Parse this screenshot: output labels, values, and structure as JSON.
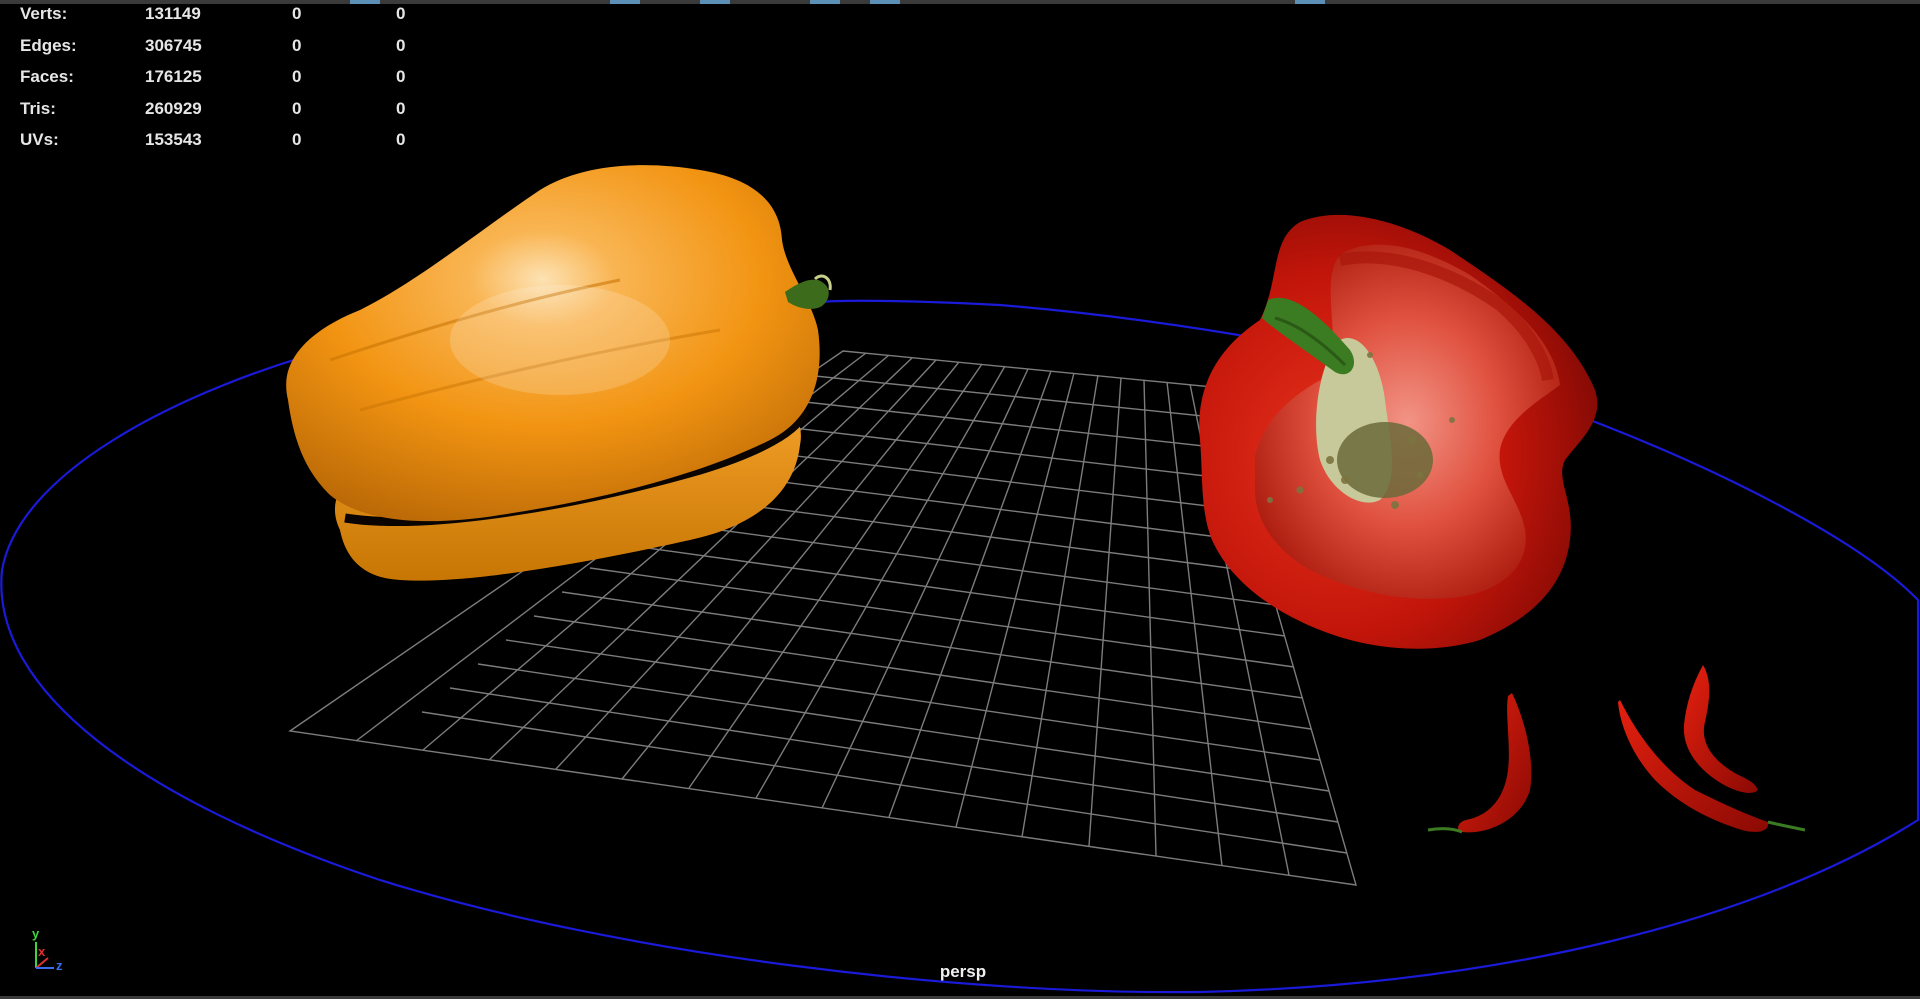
{
  "hud": {
    "rows": [
      {
        "label": "Verts:",
        "total": "131149",
        "selected": "0",
        "component": "0"
      },
      {
        "label": "Edges:",
        "total": "306745",
        "selected": "0",
        "component": "0"
      },
      {
        "label": "Faces:",
        "total": "176125",
        "selected": "0",
        "component": "0"
      },
      {
        "label": "Tris:",
        "total": "260929",
        "selected": "0",
        "component": "0"
      },
      {
        "label": "UVs:",
        "total": "153543",
        "selected": "0",
        "component": "0"
      }
    ]
  },
  "camera_label": "persp",
  "axis_gizmo": {
    "y": "y",
    "x": "x",
    "z": "z"
  },
  "colors": {
    "background": "#000000",
    "grid": "#8a8a8a",
    "ring": "#1a1ad8",
    "yellow_pepper": "#f29412",
    "red_pepper": "#c8160c",
    "axis_y": "#3dd63d",
    "axis_x": "#e03030",
    "axis_z": "#3a6cf0"
  },
  "objects": [
    "yellow-bell-pepper",
    "halved-red-bell-pepper",
    "red-chili-pepper",
    "red-chili-pepper",
    "red-chili-pepper"
  ]
}
